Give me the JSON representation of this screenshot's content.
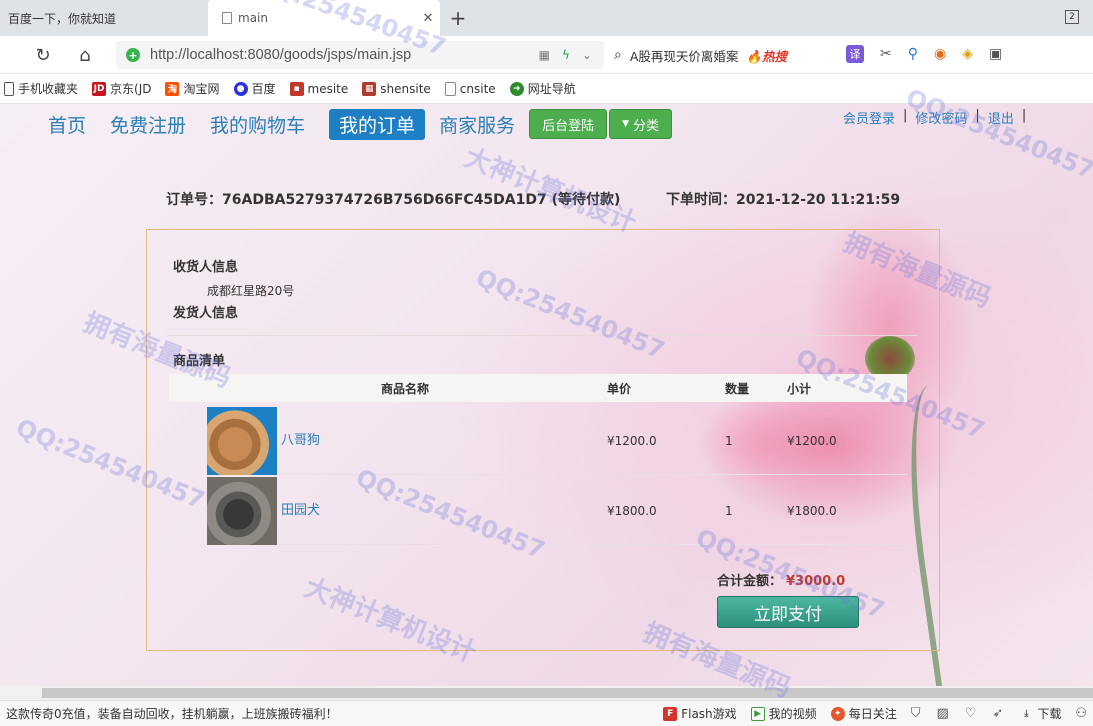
{
  "browser": {
    "tabs": [
      {
        "title": "百度一下，你就知道",
        "active": false
      },
      {
        "title": "main",
        "active": true
      }
    ],
    "tab_count": "2",
    "url": "http://localhost:8080/goods/jsps/main.jsp",
    "search_text": "A股再现天价离婚案",
    "search_hot": "🔥热搜",
    "translate_label": "译",
    "bookmarks": [
      {
        "label": "手机收藏夹",
        "icon": "phone-icon",
        "color": "#555555"
      },
      {
        "label": "京东(JD",
        "icon": "jd-icon",
        "color": "#c4161c"
      },
      {
        "label": "淘宝网",
        "icon": "taobao-icon",
        "color": "#ff5000"
      },
      {
        "label": "百度",
        "icon": "baidu-icon",
        "color": "#2932e1"
      },
      {
        "label": "mesite",
        "icon": "mesite-icon",
        "color": "#c0392b"
      },
      {
        "label": "shensite",
        "icon": "shensite-icon",
        "color": "#b03a2e"
      },
      {
        "label": "cnsite",
        "icon": "page-icon",
        "color": "#888888"
      },
      {
        "label": "网址导航",
        "icon": "nav-icon",
        "color": "#2e8b2e"
      }
    ]
  },
  "site": {
    "nav": {
      "home": "首页",
      "register": "免费注册",
      "cart": "我的购物车",
      "orders": "我的订单",
      "merchant": "商家服务",
      "admin_login": "后台登陆",
      "category": "分类"
    },
    "user_links": {
      "login": "会员登录",
      "change_pwd": "修改密码",
      "logout": "退出",
      "sep": "|"
    }
  },
  "order": {
    "id_label": "订单号：",
    "id": "76ADBA5279374726B756D66FC45DA1D7",
    "status": "(等待付款)",
    "time_label": "下单时间：",
    "time": "2021-12-20 11:21:59",
    "receiver_title": "收货人信息",
    "receiver_address": "成都红星路20号",
    "sender_title": "发货人信息",
    "list_title": "商品清单",
    "columns": [
      "商品名称",
      "单价",
      "数量",
      "小计"
    ],
    "items": [
      {
        "name": "八哥狗",
        "price": "¥1200.0",
        "qty": "1",
        "subtotal": "¥1200.0"
      },
      {
        "name": "田园犬",
        "price": "¥1800.0",
        "qty": "1",
        "subtotal": "¥1800.0"
      }
    ],
    "total_label": "合计金额：",
    "total": "¥3000.0",
    "pay_button": "立即支付"
  },
  "statusbar": {
    "ad": "这款传奇0充值，装备自动回收，挂机躺赢，上班族搬砖福利！",
    "flash": "Flash游戏",
    "video": "我的视频",
    "daily": "每日关注",
    "download": "下载"
  },
  "watermarks": {
    "qq": "QQ:254540457",
    "source": "拥有海量源码",
    "design": "大神计算机设计"
  },
  "colors": {
    "link": "#2b7fb8",
    "active_nav": "#1e7fc4",
    "green_button": "#4cae4c",
    "total_red": "#c0392b",
    "pay_button": "#2c8f7c"
  }
}
